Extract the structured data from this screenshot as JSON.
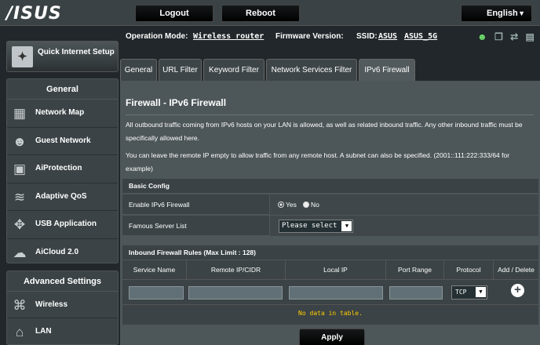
{
  "brand": "/ISUS",
  "topbar": {
    "logout": "Logout",
    "reboot": "Reboot",
    "language": "English"
  },
  "status": {
    "opmode_label": "Operation Mode:",
    "opmode_value": "Wireless router",
    "fw_label": "Firmware Version:",
    "ssid_label": "SSID:",
    "ssid1": "ASUS",
    "ssid2": "ASUS_5G"
  },
  "sidebar": {
    "quick_setup": "Quick Internet Setup",
    "general_head": "General",
    "general_items": [
      "Network Map",
      "Guest Network",
      "AiProtection",
      "Adaptive QoS",
      "USB Application",
      "AiCloud 2.0"
    ],
    "advanced_head": "Advanced Settings",
    "advanced_items": [
      "Wireless",
      "LAN"
    ]
  },
  "tabs": [
    "General",
    "URL Filter",
    "Keyword Filter",
    "Network Services Filter",
    "IPv6 Firewall"
  ],
  "page": {
    "title": "Firewall - IPv6 Firewall",
    "desc1": "All outbound traffic coming from IPv6 hosts on your LAN is allowed, as well as related inbound traffic. Any other inbound traffic must be specifically allowed here.",
    "desc2": "You can leave the remote IP empty to allow traffic from any remote host. A subnet can also be specified. (2001::111:222:333/64 for example)"
  },
  "basic": {
    "head": "Basic Config",
    "enable_label": "Enable IPv6 Firewall",
    "yes": "Yes",
    "no": "No",
    "famous_label": "Famous Server List",
    "famous_value": "Please select"
  },
  "rules": {
    "head": "Inbound Firewall Rules (Max Limit : 128)",
    "columns": [
      "Service Name",
      "Remote IP/CIDR",
      "Local IP",
      "Port Range",
      "Protocol",
      "Add / Delete"
    ],
    "protocol_value": "TCP",
    "empty": "No data in table."
  },
  "apply": "Apply"
}
